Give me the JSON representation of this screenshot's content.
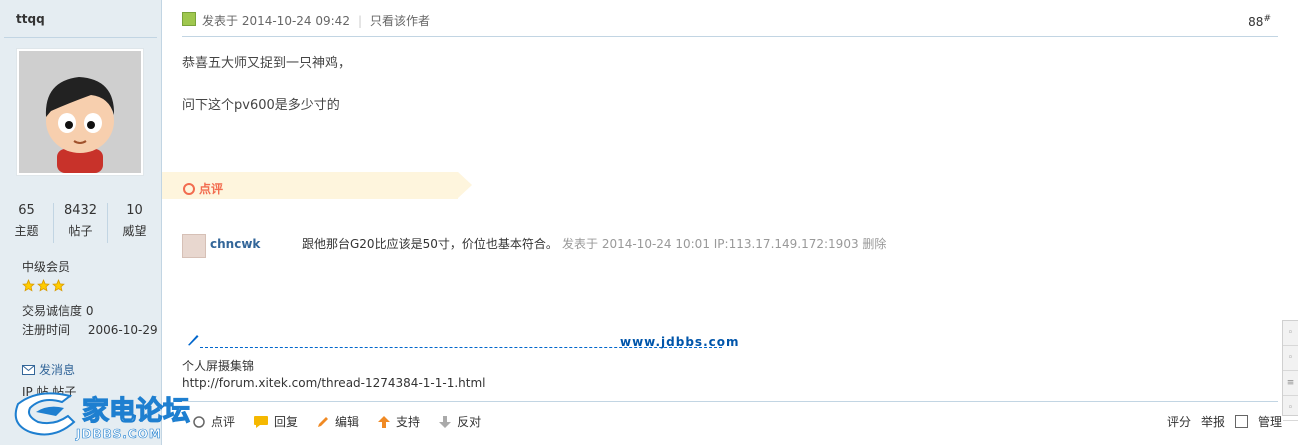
{
  "author": {
    "name": "ttqq",
    "stats": [
      {
        "value": "65",
        "label": "主题"
      },
      {
        "value": "8432",
        "label": "帖子"
      },
      {
        "value": "10",
        "label": "威望"
      }
    ],
    "rank": "中级会员",
    "stars": 3,
    "credit": "交易诚信度 0",
    "register_label": "注册时间",
    "register_date": "2006-10-29",
    "message_link": "发消息",
    "partial_line": "IP  帖  帖子"
  },
  "post": {
    "posted_at": "发表于 2014-10-24 09:42",
    "author_only": "只看该作者",
    "floor": "88",
    "floor_suffix": "#",
    "lines": [
      "恭喜五大师又捉到一只神鸡，",
      "问下这个pv600是多少寸的"
    ]
  },
  "comments": {
    "header": "点评",
    "items": [
      {
        "user": "chncwk",
        "text": "跟他那台G20比应该是50寸，价位也基本符合。",
        "meta": "发表于 2014-10-24 10:01 IP:113.17.149.172:1903 删除"
      }
    ]
  },
  "signature": {
    "site": "www.jdbbs.com",
    "name": "个人屏摄集锦",
    "link": "http://forum.xitek.com/thread-1274384-1-1-1.html"
  },
  "actions": [
    {
      "icon": "comment-icon",
      "label": "点评",
      "color": "#666666"
    },
    {
      "icon": "reply-icon",
      "label": "回复",
      "color": "#f5b800"
    },
    {
      "icon": "edit-icon",
      "label": "编辑",
      "color": "#f08a24"
    },
    {
      "icon": "support-icon",
      "label": "支持",
      "color": "#f08a24"
    },
    {
      "icon": "oppose-icon",
      "label": "反对",
      "color": "#aaaaaa"
    }
  ],
  "tools": {
    "rate": "评分",
    "report": "举报",
    "manage": "管理"
  },
  "logo": {
    "text_cn": "家电论坛",
    "text_en": "JDBBS.COM",
    "color": "#1e7fd0"
  },
  "colors": {
    "sidebar_bg": "#e5edf2",
    "border": "#c2d5e3",
    "rate_bg": "#fef5dd",
    "accent": "#f26c4f"
  }
}
